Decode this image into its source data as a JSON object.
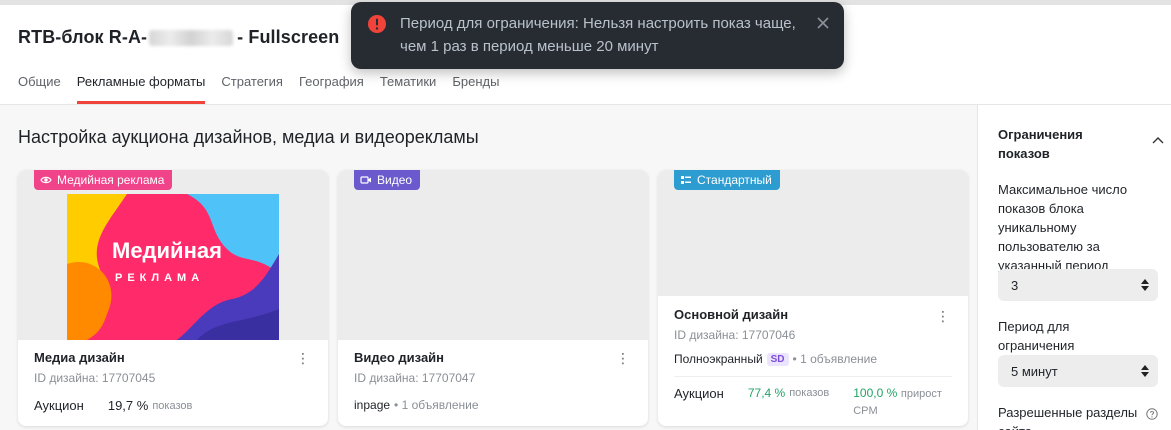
{
  "header": {
    "title_prefix": "RTB-блок R-A-",
    "title_suffix": "- Fullscreen"
  },
  "tabs": [
    {
      "label": "Общие"
    },
    {
      "label": "Рекламные форматы"
    },
    {
      "label": "Стратегия"
    },
    {
      "label": "География"
    },
    {
      "label": "Тематики"
    },
    {
      "label": "Бренды"
    }
  ],
  "main": {
    "section_title": "Настройка аукциона дизайнов, медиа и видеорекламы",
    "cards": [
      {
        "badge": "Медийная реклама",
        "badge_color": "#f0438a",
        "preview_text_1": "Медийная",
        "preview_text_2": "РЕКЛАМА",
        "name": "Медиа дизайн",
        "id_label": "ID дизайна: 17707045",
        "auction_label": "Аукцион",
        "auction_pct": "19,7 %",
        "auction_unit": "показов"
      },
      {
        "badge": "Видео",
        "badge_color": "#6a5acd",
        "name": "Видео дизайн",
        "id_label": "ID дизайна: 17707047",
        "info_main": "inpage",
        "info_sub": "• 1 объявление"
      },
      {
        "badge": "Стандартный",
        "badge_color": "#2d9cd0",
        "name": "Основной дизайн",
        "id_label": "ID дизайна: 17707046",
        "info_main": "Полноэкранный",
        "info_tag": "SD",
        "info_sub": "• 1 объявление",
        "auction_label": "Аукцион",
        "auction_pct": "77,4 %",
        "auction_unit": "показов",
        "growth_pct": "100,0 %",
        "growth_unit": "прирост",
        "growth_unit_2": "CPM"
      }
    ]
  },
  "sidebar": {
    "title": "Ограничения показов",
    "max_label": "Максимальное число показов блока уникальному пользователю за указанный период",
    "max_value": "3",
    "period_label": "Период для ограничения",
    "period_value": "5 минут",
    "sections_label": "Разрешенные разделы сайта"
  },
  "toast": {
    "message": "Период для ограничения: Нельзя настроить показ чаще, чем 1 раз в период меньше 20 минут"
  },
  "colors": {
    "accent": "#f0443b",
    "green": "#23a366",
    "toast_bg": "#272c33",
    "error": "#f0443b"
  }
}
